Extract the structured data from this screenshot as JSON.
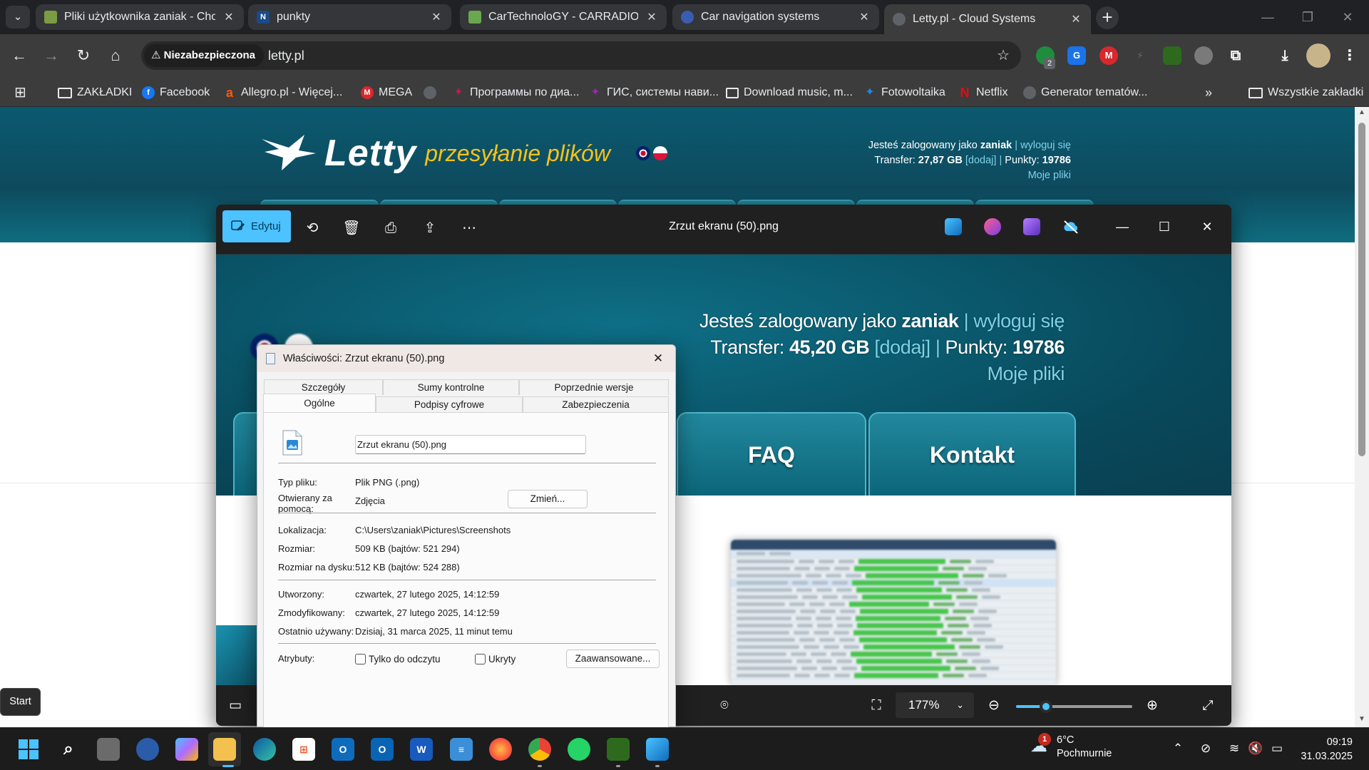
{
  "tabs": [
    {
      "title": "Pliki użytkownika zaniak - Chom",
      "color": "#7b9c42"
    },
    {
      "title": "punkty",
      "color": "#1b4a8a"
    },
    {
      "title": "CarTechnoloGY - CARRADIO / N",
      "color": "#6aa84f"
    },
    {
      "title": "Car navigation systems",
      "color": "#3b5db1"
    },
    {
      "title": "Letty.pl - Cloud Systems",
      "color": "#5f6368",
      "active": true
    }
  ],
  "toolbar": {
    "security": "Niezabezpieczona",
    "url": "letty.pl",
    "ext_badge": "2"
  },
  "bookmarks": {
    "items": [
      {
        "label": "ZAKŁADKI",
        "icon": "folder-icon",
        "color": "transparent"
      },
      {
        "label": "Facebook",
        "icon": "facebook-icon",
        "color": "#1877f2"
      },
      {
        "label": "Allegro.pl - Więcej...",
        "icon": "allegro-icon",
        "color": "#ff5a00"
      },
      {
        "label": "MEGA",
        "icon": "mega-icon",
        "color": "#d9272e"
      },
      {
        "label": "",
        "icon": "globe-icon",
        "color": "#5f6368"
      },
      {
        "label": "Программы по диа...",
        "icon": "programs-icon",
        "color": "#c2185b"
      },
      {
        "label": "ГИС, системы нави...",
        "icon": "gis-icon",
        "color": "#9c27b0"
      },
      {
        "label": "Download music, m...",
        "icon": "music-icon",
        "color": "#444"
      },
      {
        "label": "Fotowoltaika",
        "icon": "solar-icon",
        "color": "#1e88e5"
      },
      {
        "label": "Netflix",
        "icon": "netflix-icon",
        "color": "#e50914"
      },
      {
        "label": "Generator tematów...",
        "icon": "generator-icon",
        "color": "#5f6368"
      }
    ],
    "all": "Wszystkie zakładki"
  },
  "site": {
    "logo": "Letty",
    "tagline": "przesyłanie plików",
    "logged_prefix": "Jesteś zalogowany jako",
    "user": "zaniak",
    "logout": "wyloguj się",
    "transfer_label": "Transfer:",
    "transfer": "27,87 GB",
    "add": "[dodaj]",
    "points_label": "Punkty:",
    "points": "19786",
    "my_files": "Moje pliki"
  },
  "photos": {
    "edit": "Edytuj",
    "title": "Zrzut ekranu (50).png",
    "zoom": "177%",
    "zoomed": {
      "logged_prefix": "Jesteś zalogowany jako",
      "user": "zaniak",
      "logout": "wyloguj się",
      "transfer_label": "Transfer:",
      "transfer": "45,20 GB",
      "add": "[dodaj]",
      "points_label": "Punkty:",
      "points": "19786",
      "my_files": "Moje pliki",
      "tab_faq": "FAQ",
      "tab_contact": "Kontakt"
    }
  },
  "props": {
    "title": "Właściwości: Zrzut ekranu (50).png",
    "tabs_row1": [
      "Szczegóły",
      "Sumy kontrolne",
      "Poprzednie wersje"
    ],
    "tabs_row2": [
      "Ogólne",
      "Podpisy cyfrowe",
      "Zabezpieczenia"
    ],
    "filename": "Zrzut ekranu (50).png",
    "type_label": "Typ pliku:",
    "type": "Plik PNG (.png)",
    "opens_label": "Otwierany za pomocą:",
    "opens": "Zdjęcia",
    "change": "Zmień...",
    "location_label": "Lokalizacja:",
    "location": "C:\\Users\\zaniak\\Pictures\\Screenshots",
    "size_label": "Rozmiar:",
    "size": "509 KB (bajtów: 521 294)",
    "disk_label": "Rozmiar na dysku:",
    "disk": "512 KB (bajtów: 524 288)",
    "created_label": "Utworzony:",
    "created": "czwartek, 27 lutego 2025, 14:12:59",
    "modified_label": "Zmodyfikowany:",
    "modified": "czwartek, 27 lutego 2025, 14:12:59",
    "accessed_label": "Ostatnio używany:",
    "accessed": "Dzisiaj, 31 marca 2025, 11 minut temu",
    "attr_label": "Atrybuty:",
    "readonly": "Tylko do odczytu",
    "hidden": "Ukryty",
    "advanced": "Zaawansowane..."
  },
  "start_tip": "Start",
  "taskbar": {
    "temp": "6°C",
    "condition": "Pochmurnie",
    "badge": "1",
    "time": "09:19",
    "date": "31.03.2025"
  }
}
